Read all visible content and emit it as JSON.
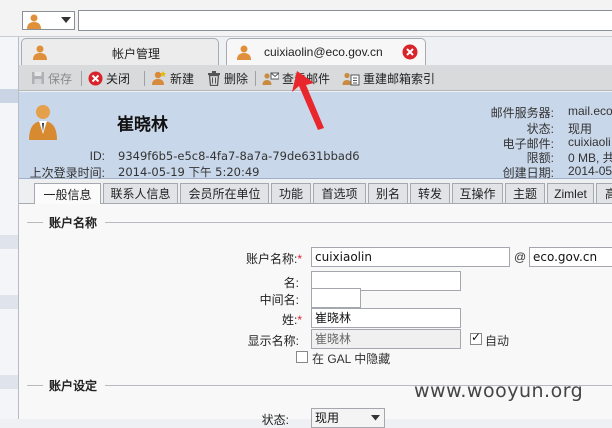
{
  "tabs": {
    "account_mgmt": "帐户管理",
    "user_tab": "cuixiaolin@eco.gov.cn"
  },
  "toolbar": {
    "save": "保存",
    "close": "关闭",
    "new": "新建",
    "delete": "删除",
    "view_mail": "查看邮件",
    "reindex": "重建邮箱索引"
  },
  "header": {
    "name": "崔晓林",
    "id_label": "ID:",
    "id_value": "9349f6b5-e5c8-4fa7-8a7a-79de631bbad6",
    "last_login_label": "上次登录时间:",
    "last_login_value": "2014-05-19 下午 5:20:49",
    "mail_server_label": "邮件服务器:",
    "mail_server_value": "mail.eco",
    "status_label": "状态:",
    "status_value": "现用",
    "email_label": "电子邮件:",
    "email_value": "cuixiaoli",
    "quota_label": "限额:",
    "quota_value": "0 MB, 共",
    "created_label": "创建日期:",
    "created_value": "2014-05"
  },
  "subtabs": [
    "一般信息",
    "联系人信息",
    "会员所在单位",
    "功能",
    "首选项",
    "别名",
    "转发",
    "互操作",
    "主题",
    "Zimlet",
    "高"
  ],
  "section_account_name": "账户名称",
  "form": {
    "account_name_label": "账户名称:",
    "account_name_value": "cuixiaolin",
    "at": "@",
    "domain_value": "eco.gov.cn",
    "first_name_label": "名:",
    "first_name_value": "",
    "middle_name_label": "中间名:",
    "middle_name_value": "",
    "last_name_label": "姓:",
    "last_name_value": "崔晓林",
    "display_name_label": "显示名称:",
    "display_name_value": "崔晓林",
    "auto_label": "自动",
    "hide_gal_label": "在 GAL 中隐藏"
  },
  "section_account_settings": "账户设定",
  "status_row": {
    "label": "状态:",
    "value": "现用"
  },
  "watermark": "www.wooyun.org",
  "colors": {
    "header_bg": "#c9d7ea",
    "toolbar_bg": "#d9dadc",
    "annotation_arrow": "#e8262b"
  }
}
